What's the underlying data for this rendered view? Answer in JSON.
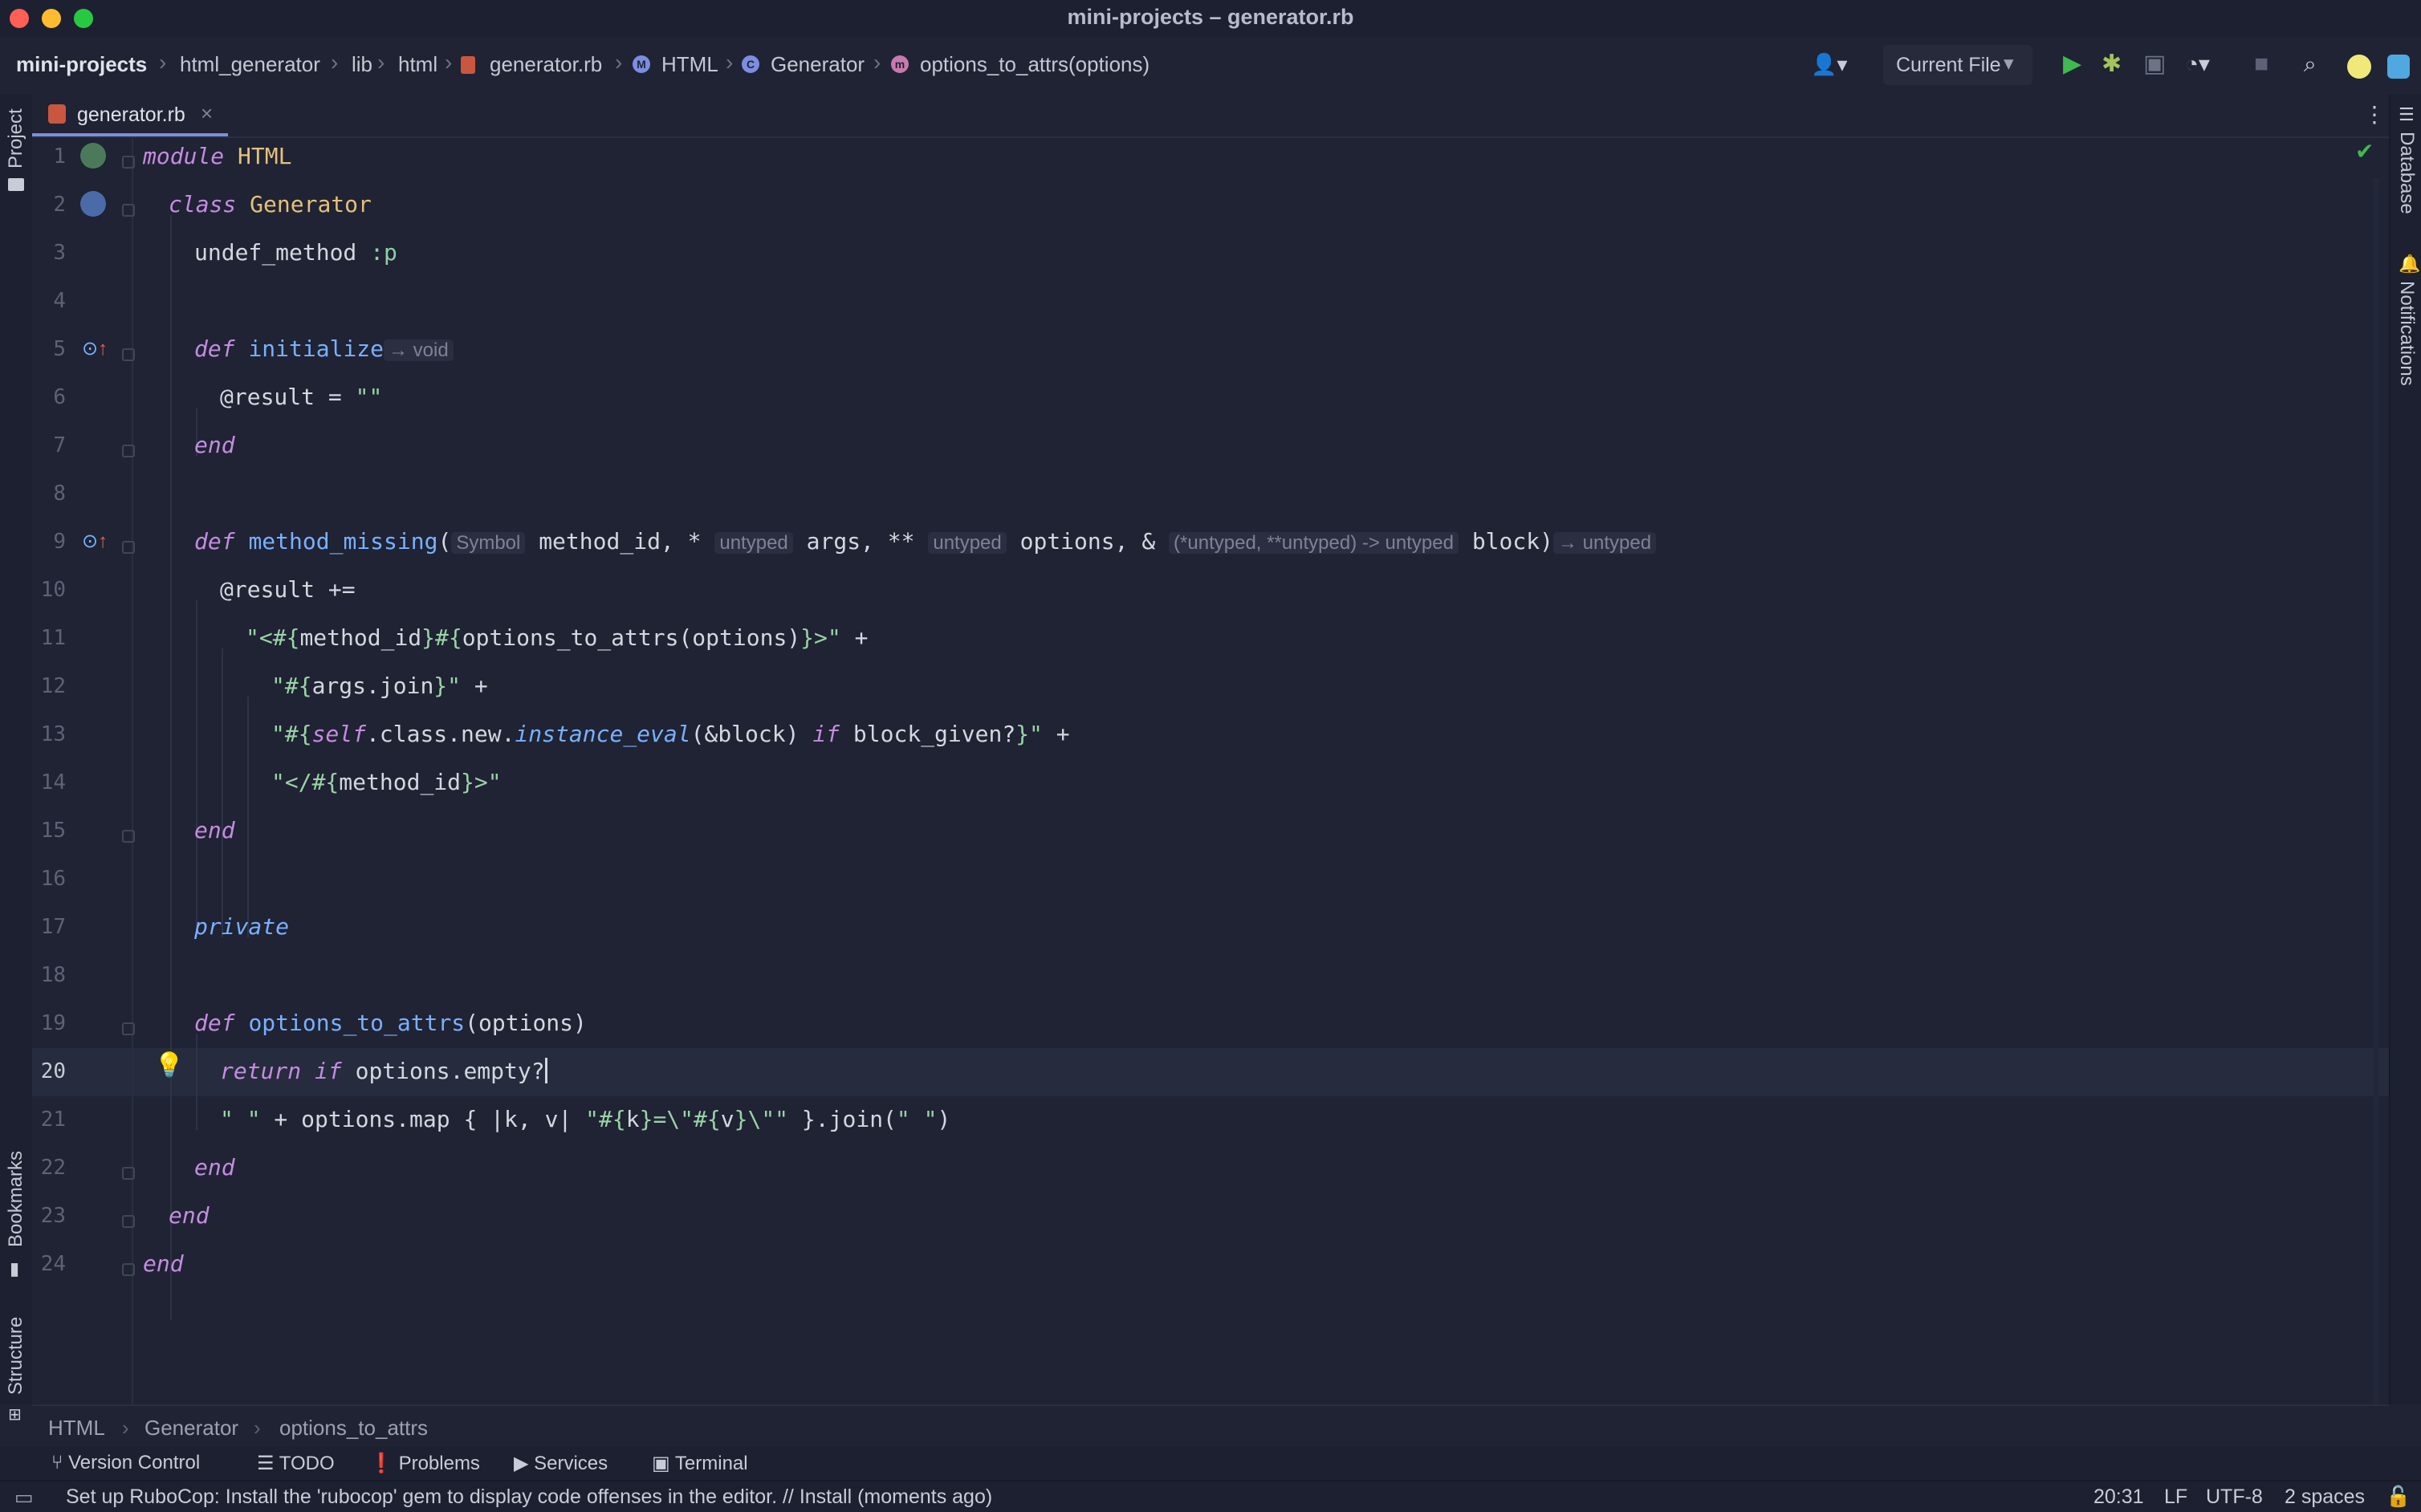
{
  "window": {
    "title": "mini-projects – generator.rb"
  },
  "breadcrumb": {
    "project": "mini-projects",
    "items": [
      "html_generator",
      "lib",
      "html",
      "generator.rb",
      "HTML",
      "Generator",
      "options_to_attrs(options)"
    ]
  },
  "toolbar": {
    "run_config": "Current File"
  },
  "left_stripe": {
    "project": "Project",
    "bookmarks": "Bookmarks",
    "structure": "Structure"
  },
  "right_stripe": {
    "database": "Database",
    "notifications": "Notifications"
  },
  "tab": {
    "label": "generator.rb"
  },
  "editor": {
    "line_numbers": [
      "1",
      "2",
      "3",
      "4",
      "5",
      "6",
      "7",
      "8",
      "9",
      "10",
      "11",
      "12",
      "13",
      "14",
      "15",
      "16",
      "17",
      "18",
      "19",
      "20",
      "21",
      "22",
      "23",
      "24"
    ],
    "active_line": "20",
    "code": {
      "l1_kw": "module",
      "l1_name": "HTML",
      "l2_kw": "class",
      "l2_name": "Generator",
      "l3_a": "undef_method",
      "l3_b": ":p",
      "l5_kw": "def",
      "l5_name": "initialize",
      "l5_hint": "→ void",
      "l6_a": "@result",
      "l6_b": " = ",
      "l6_c": "\"\"",
      "l7_kw": "end",
      "l9_kw": "def",
      "l9_name": "method_missing",
      "l9_p1": "(",
      "l9_h1": "Symbol",
      "l9_a1": "method_id, *",
      "l9_h2": "untyped",
      "l9_a2": "args, **",
      "l9_h3": "untyped",
      "l9_a3": "options, &",
      "l9_h4": "(*untyped, **untyped) -> untyped",
      "l9_a4": "block)",
      "l9_h5": "→ untyped",
      "l10": "@result +=",
      "l11_s1": "\"<#{",
      "l11_a": "method_id",
      "l11_s2": "}#{",
      "l11_b": "options_to_attrs(options)",
      "l11_s3": "}>\"",
      "l11_c": " +",
      "l12_s1": "\"#{",
      "l12_a": "args.join",
      "l12_s2": "}\"",
      "l12_c": " +",
      "l13_s1": "\"#{",
      "l13_self": "self",
      "l13_a": ".class.new.",
      "l13_it": "instance_eval",
      "l13_b": "(&block) ",
      "l13_kw": "if",
      "l13_c": " block_given?",
      "l13_s2": "}\"",
      "l13_d": " +",
      "l14_s1": "\"</#{",
      "l14_a": "method_id",
      "l14_s2": "}>\"",
      "l15_kw": "end",
      "l17_kw": "private",
      "l19_kw": "def",
      "l19_name": "options_to_attrs",
      "l19_a": "(options)",
      "l20_kw1": "return",
      "l20_kw2": "if",
      "l20_a": " options.",
      "l20_b": "empty?",
      "l21_s1": "\" \"",
      "l21_a": " + options.map { |k, v| ",
      "l21_s2": "\"#{",
      "l21_b": "k",
      "l21_s3": "}=\\\"#{",
      "l21_c": "v",
      "l21_s4": "}\\\"\"",
      "l21_d": " }.join(",
      "l21_s5": "\" \"",
      "l21_e": ")",
      "l22_kw": "end",
      "l23_kw": "end",
      "l24_kw": "end"
    }
  },
  "bottom_crumbs": [
    "HTML",
    "Generator",
    "options_to_attrs"
  ],
  "tool_windows": [
    "Version Control",
    "TODO",
    "Problems",
    "Services",
    "Terminal"
  ],
  "status": {
    "message": "Set up RuboCop: Install the 'rubocop' gem to display code offenses in the editor. // Install (moments ago)",
    "position": "20:31",
    "line_sep": "LF",
    "encoding": "UTF-8",
    "indent": "2 spaces"
  },
  "colors": {
    "bg": "#1f2333",
    "accent": "#7a8fe0",
    "run": "#3fb950",
    "debug": "#a5c25c"
  }
}
